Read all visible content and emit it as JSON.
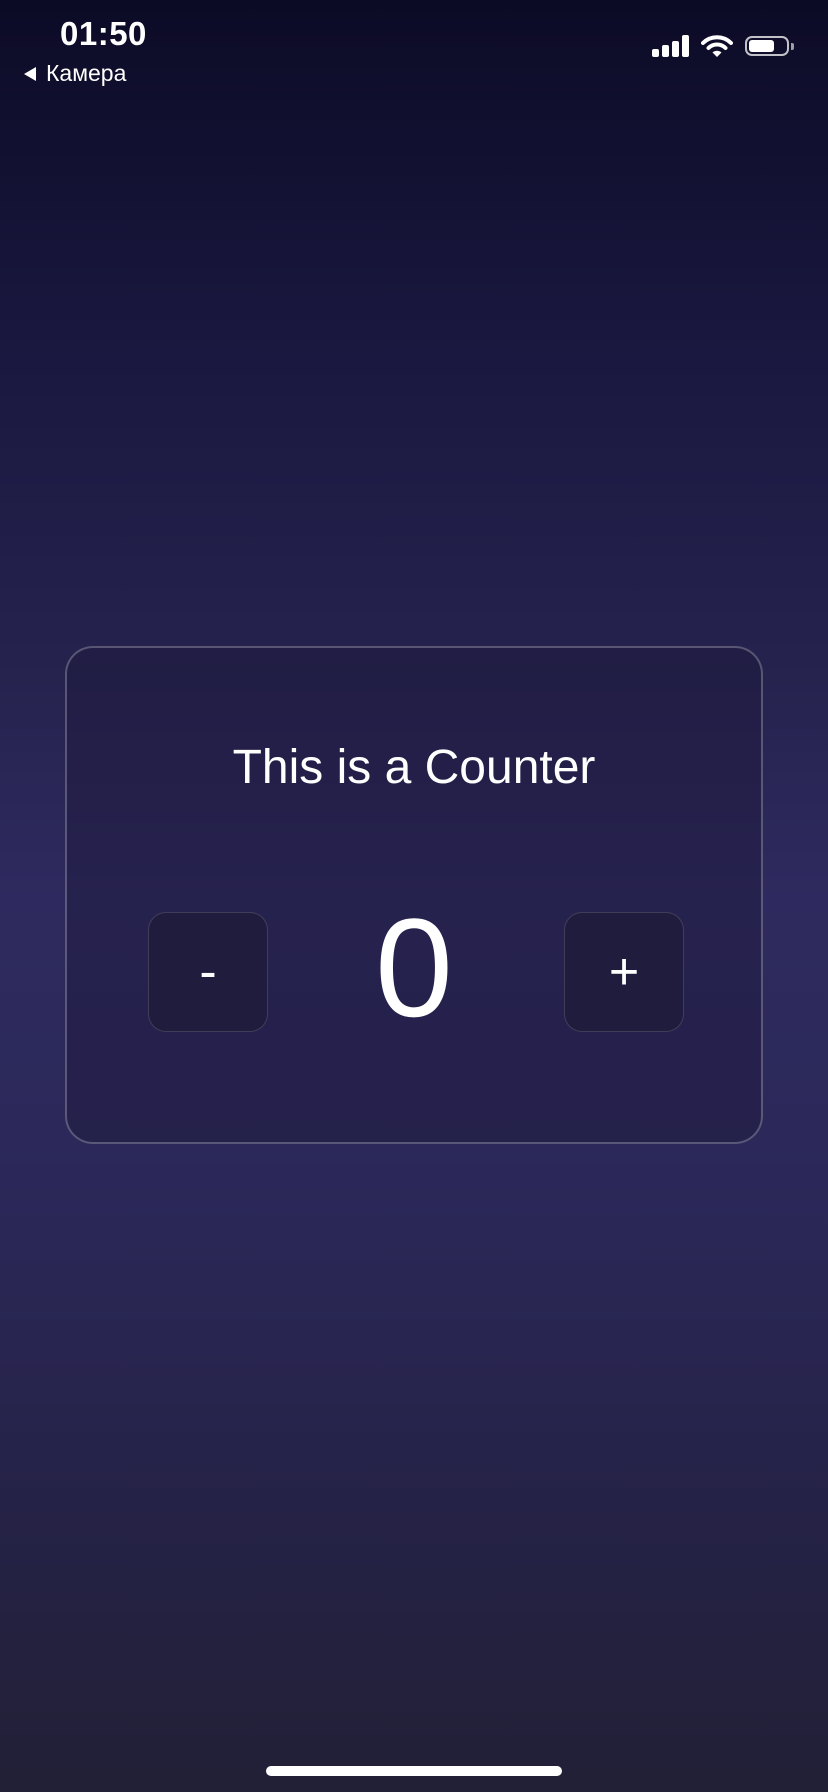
{
  "status_bar": {
    "time": "01:50",
    "back_label": "Камера",
    "signal_icon": "cellular-signal-icon",
    "wifi_icon": "wifi-icon",
    "battery_icon": "battery-icon",
    "battery_level": 0.7
  },
  "counter": {
    "title": "This is a Counter",
    "value": "0",
    "decrement_label": "-",
    "increment_label": "+"
  },
  "colors": {
    "background_top": "#0c0b26",
    "background_middle": "#2e2a5f",
    "background_bottom": "#222036",
    "card_border": "#5a5775",
    "button_background": "#201c3d",
    "text": "#ffffff"
  }
}
